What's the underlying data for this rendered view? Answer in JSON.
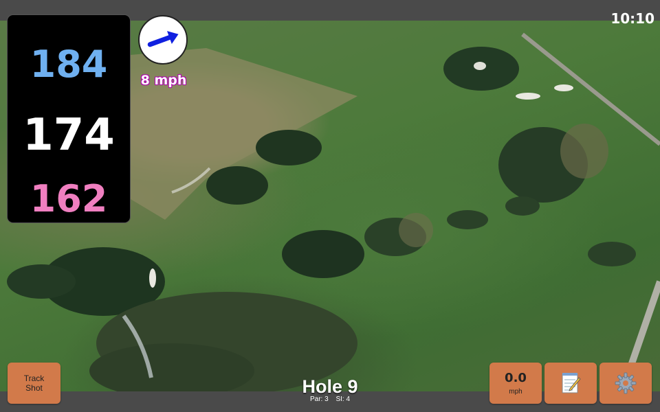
{
  "status": {
    "time": "10:10"
  },
  "yardages": {
    "back": "184",
    "middle": "174",
    "front": "162"
  },
  "wind": {
    "speed": "8 mph",
    "icon": "wind-arrow-icon"
  },
  "hole": {
    "title": "Hole 9",
    "par": "Par: 3",
    "si": "SI: 4"
  },
  "buttons": {
    "track_shot_line1": "Track",
    "track_shot_line2": "Shot",
    "speed_value": "0.0",
    "speed_unit": "mph",
    "notes_icon": "notepad-icon",
    "settings_icon": "gear-icon"
  },
  "colors": {
    "back": "#6fb0f0",
    "middle": "#ffffff",
    "front": "#f07fc0",
    "button": "#d27a4a",
    "wind_arrow": "#1020e0"
  }
}
